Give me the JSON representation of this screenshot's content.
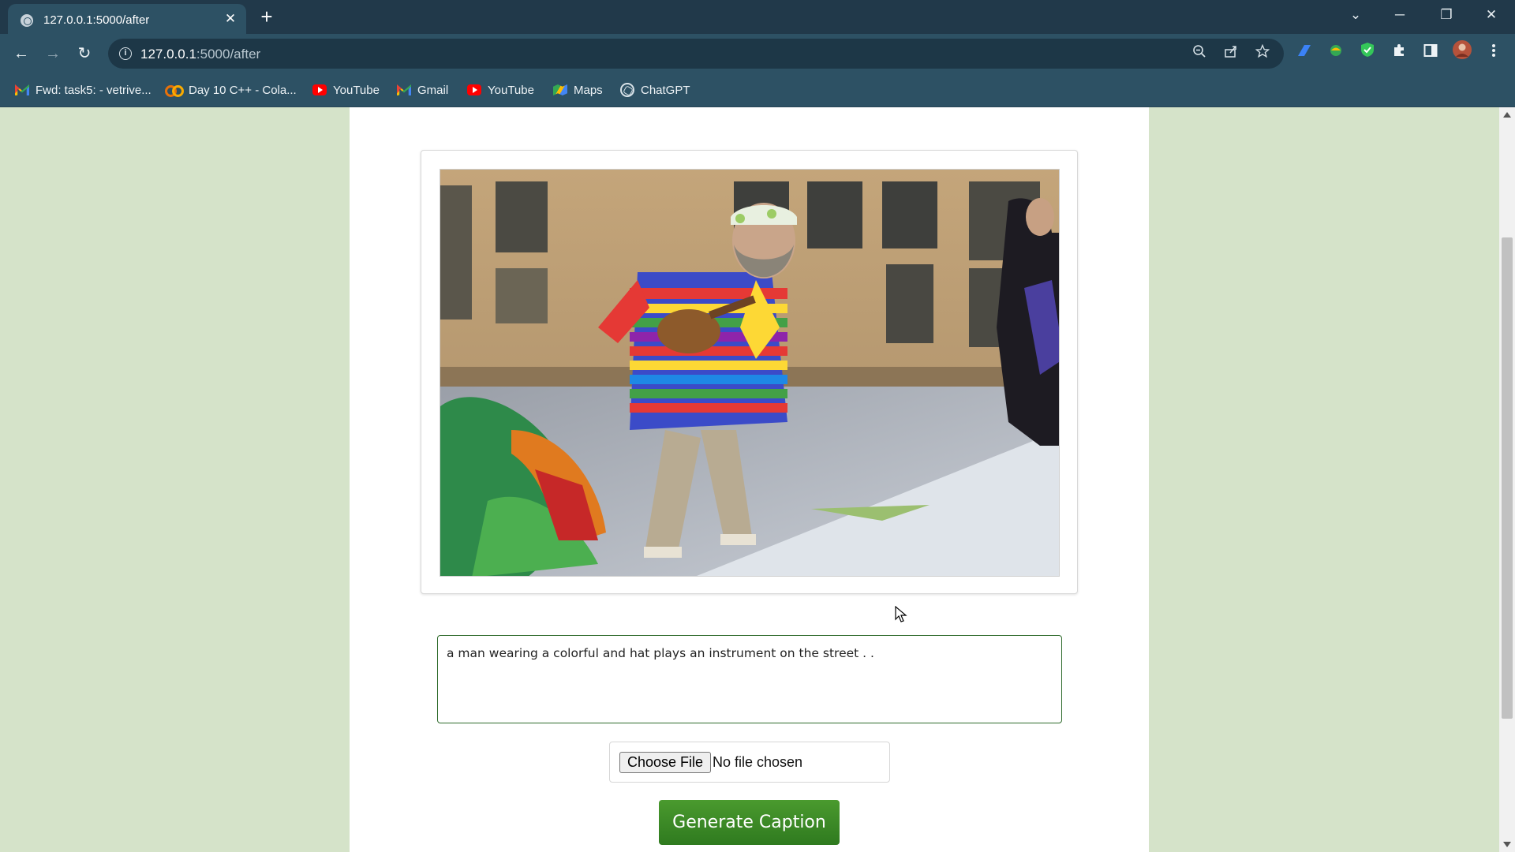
{
  "browser": {
    "tab_title": "127.0.0.1:5000/after",
    "tab_close_glyph": "✕",
    "new_tab_glyph": "+",
    "url_host": "127.0.0.1",
    "url_path": ":5000/after",
    "window_controls": {
      "list": "⌄",
      "minimize": "─",
      "restore": "❐",
      "close": "✕"
    },
    "nav": {
      "back": "←",
      "forward": "→",
      "reload": "↻"
    },
    "omnibox_icons": [
      "zoom-icon",
      "share-icon",
      "bookmark-star-icon"
    ],
    "extensions": [
      "extension-blue-icon",
      "extension-green-icon",
      "shield-extension-icon",
      "puzzle-icon",
      "side-panel-icon",
      "profile-avatar",
      "kebab-menu-icon"
    ]
  },
  "bookmarks": [
    {
      "label": "Fwd: task5: - vetrive...",
      "icon": "gmail-icon"
    },
    {
      "label": "Day 10 C++ - Cola...",
      "icon": "colab-icon"
    },
    {
      "label": "YouTube",
      "icon": "youtube-icon"
    },
    {
      "label": "Gmail",
      "icon": "gmail-icon"
    },
    {
      "label": "YouTube",
      "icon": "youtube-icon"
    },
    {
      "label": "Maps",
      "icon": "maps-icon"
    },
    {
      "label": "ChatGPT",
      "icon": "chatgpt-icon"
    }
  ],
  "page": {
    "caption_text": "a man wearing a colorful and hat plays an instrument on the street . .",
    "file_button_label": "Choose File",
    "file_status": "No file chosen",
    "generate_button_label": "Generate Caption"
  },
  "colors": {
    "page_background": "#d5e3c9",
    "chrome_dark": "#21394a",
    "chrome_toolbar": "#2d5164",
    "accent_green": "#3a8a26"
  }
}
